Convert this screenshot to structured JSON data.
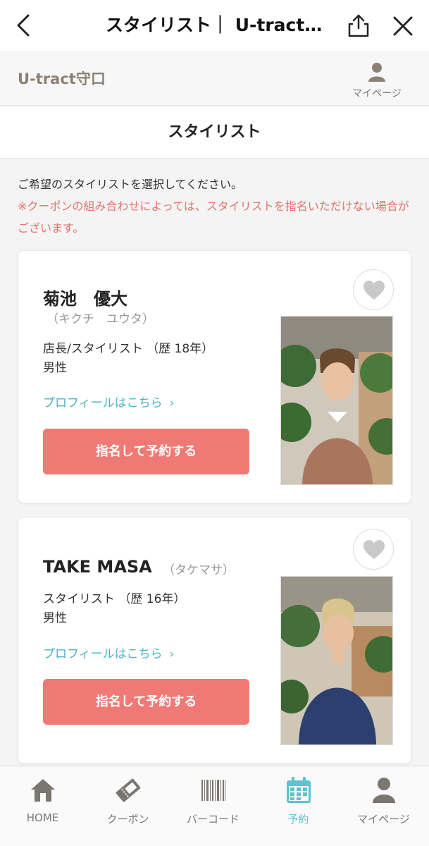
{
  "appbar": {
    "title": "スタイリスト｜ U-tract守口"
  },
  "site": {
    "brand": "U-tract守口",
    "mypage_label": "マイページ"
  },
  "page": {
    "title": "スタイリスト",
    "intro": "ご希望のスタイリストを選択してください。",
    "notice": "※クーポンの組み合わせによっては、スタイリストを指名いただけない場合がございます。"
  },
  "stylists": [
    {
      "name": "菊池　優大",
      "kana": "（キクチ　ユウタ）",
      "role": "店長/スタイリスト （歴 18年）",
      "gender": "男性",
      "profile_link": "プロフィールはこちら",
      "chevron": "›",
      "book_button": "指名して予約する",
      "favorite_icon": "heart-icon"
    },
    {
      "name": "TAKE MASA",
      "kana": "（タケマサ）",
      "role": "スタイリスト （歴 16年）",
      "gender": "男性",
      "profile_link": "プロフィールはこちら",
      "chevron": "›",
      "book_button": "指名して予約する",
      "favorite_icon": "heart-icon"
    }
  ],
  "bottom_nav": [
    {
      "label": "HOME",
      "icon": "home-icon",
      "active": false
    },
    {
      "label": "クーポン",
      "icon": "ticket-icon",
      "active": false
    },
    {
      "label": "バーコード",
      "icon": "barcode-icon",
      "active": false
    },
    {
      "label": "予約",
      "icon": "calendar-icon",
      "active": true
    },
    {
      "label": "マイページ",
      "icon": "person-icon",
      "active": false
    }
  ],
  "colors": {
    "accent": "#ef7a75",
    "link": "#4bb3c6",
    "active_nav": "#5cc3cf",
    "notice": "#e5736a",
    "brand": "#8b8275"
  }
}
